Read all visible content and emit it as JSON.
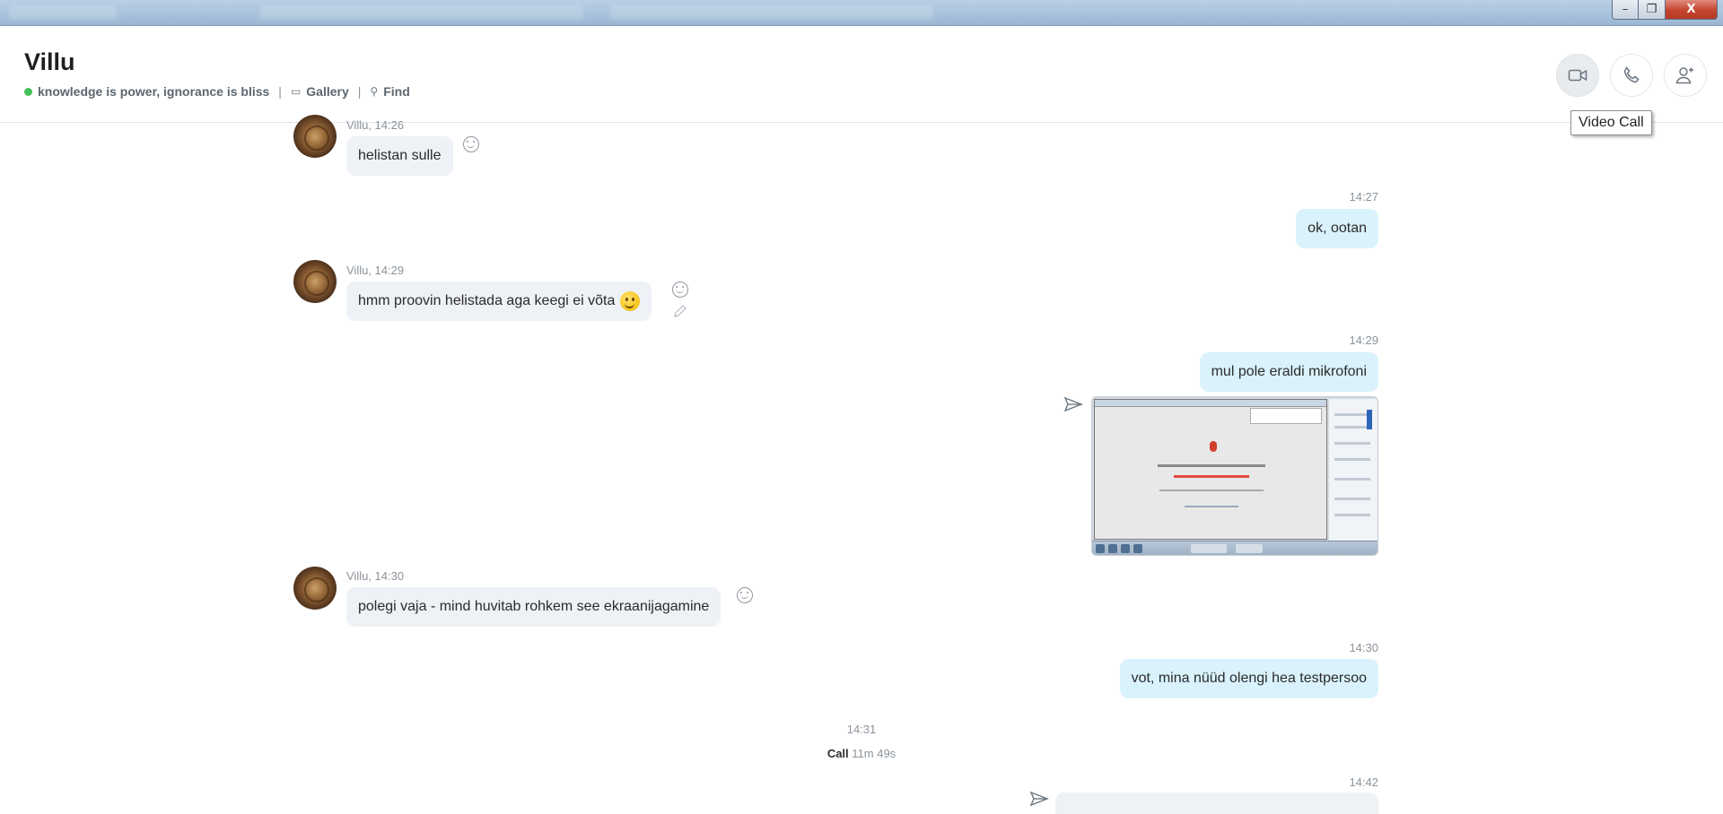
{
  "window": {
    "minimize_glyph": "–",
    "restore_glyph": "❐",
    "close_glyph": "X"
  },
  "header": {
    "contact_name": "Villu",
    "status_message": "knowledge is power, ignorance is bliss",
    "gallery_label": "Gallery",
    "find_label": "Find",
    "separator": "|",
    "status_color": "#44c05a",
    "actions": {
      "video_call_icon": "video-camera-icon",
      "audio_call_icon": "phone-icon",
      "add_people_icon": "add-person-icon"
    },
    "tooltip": "Video Call"
  },
  "messages": [
    {
      "direction": "in",
      "meta": "Villu, 14:26",
      "text": "helistan sulle"
    },
    {
      "direction": "out",
      "time": "14:27",
      "text": "ok, ootan"
    },
    {
      "direction": "in",
      "meta": "Villu, 14:29",
      "text": "hmm proovin helistada aga keegi ei võta"
    },
    {
      "direction": "out",
      "time": "14:29",
      "text": "mul pole eraldi mikrofoni"
    },
    {
      "direction": "in",
      "meta": "Villu, 14:30",
      "text": "polegi vaja - mind huvitab rohkem see ekraanijagamine"
    },
    {
      "direction": "out",
      "time": "14:30",
      "text": "vot, mina nüüd olengi hea testpersoo"
    }
  ],
  "call_event": {
    "time": "14:31",
    "label": "Call",
    "duration": "11m 49s"
  },
  "last_time": "14:42",
  "colors": {
    "incoming_bubble": "#eef1f5",
    "outgoing_bubble": "#d9f2fc"
  }
}
